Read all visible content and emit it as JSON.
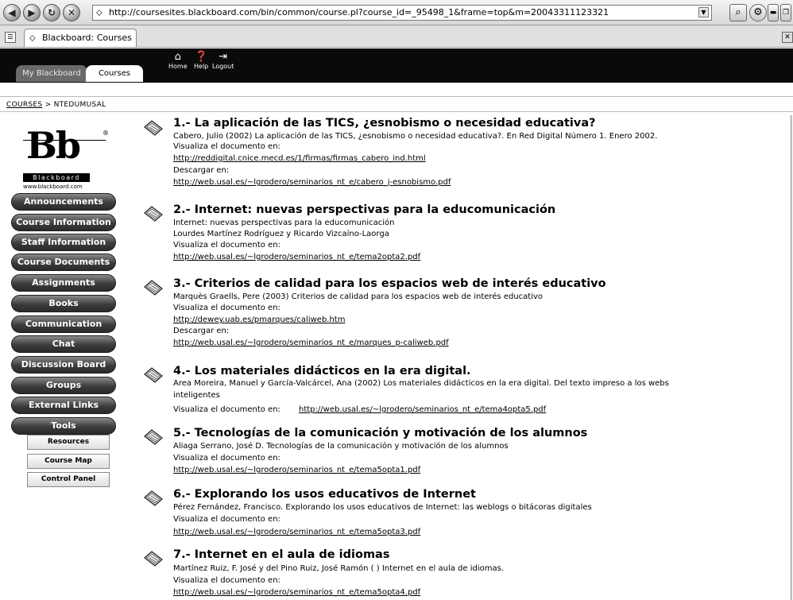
{
  "browser": {
    "url": "http://coursesites.blackboard.com/bin/common/course.pl?course_id=_95498_1&frame=top&m=20043311123321",
    "tab_title": "Blackboard: Courses"
  },
  "bb_header": {
    "tab_myblackboard": "My Blackboard",
    "tab_courses": "Courses",
    "home": "Home",
    "help": "Help",
    "logout": "Logout"
  },
  "breadcrumb": {
    "courses": "COURSES",
    "sep": " > ",
    "current": "NTEDUMUSAL"
  },
  "logo": {
    "mark": "Bb",
    "word": "Blackboard",
    "url": "www.blackboard.com"
  },
  "nav": [
    "Announcements",
    "Course Information",
    "Staff Information",
    "Course Documents",
    "Assignments",
    "Books",
    "Communication",
    "Chat",
    "Discussion Board",
    "Groups",
    "External Links",
    "Tools"
  ],
  "tools_buttons": [
    "Resources",
    "Course Map",
    "Control Panel"
  ],
  "entries": [
    {
      "title": "1.- La aplicación de las TICS, ¿esnobismo o necesidad educativa?",
      "line1": "Cabero, Julio (2002) La aplicación de las TICS, ¿esnobismo o necesidad educativa?. En Red Digital Número 1. Enero 2002.",
      "line2": "Visualiza el documento en:",
      "link1": "http://reddigital.cnice.mecd.es/1/firmas/firmas_cabero_ind.html",
      "line3": "Descargar en:",
      "link2": "http://web.usal.es/~lgrodero/seminarios_nt_e/cabero_j-esnobismo.pdf"
    },
    {
      "title": "2.- Internet: nuevas perspectivas para la educomunicación",
      "line1": "Internet: nuevas perspectivas para la educomunicación",
      "line2": "Lourdes Martínez Rodríguez y Ricardo Vizcaíno-Laorga",
      "line3": "Visualiza el documento en:",
      "link1": "http://web.usal.es/~lgrodero/seminarios_nt_e/tema2opta2.pdf"
    },
    {
      "title": "3.- Criterios de calidad para los espacios web de interés educativo",
      "line1": "Marquès Graells, Pere (2003) Criterios de calidad para los espacios web de interés educativo",
      "line2": "Visualiza el documento en:",
      "link1": "http://dewey.uab.es/pmarques/caliweb.htm",
      "line3": "Descargar en:",
      "link2": "http://web.usal.es/~lgrodero/seminarios_nt_e/marques_p-caliweb.pdf"
    },
    {
      "title": "4.- Los materiales didácticos en la era digital.",
      "line1": "Area Moreira, Manuel y García-Valcárcel, Ana (2002) Los materiales didácticos en la era digital. Del texto impreso a los webs",
      "line2": "inteligentes",
      "line3": "Visualiza el documento en:",
      "link1": "http://web.usal.es/~lgrodero/seminarios_nt_e/tema4opta5.pdf"
    },
    {
      "title": "5.- Tecnologías de la comunicación y motivación de los alumnos",
      "line1": "Aliaga Serrano, José D. Tecnologías de la comunicación y motivación de los alumnos",
      "line2": "Visualiza el documento en:",
      "link1": "http://web.usal.es/~lgrodero/seminarios_nt_e/tema5opta1.pdf"
    },
    {
      "title": "6.- Explorando los usos educativos de Internet",
      "line1": "Pérez Fernández, Francisco. Explorando los usos educativos de Internet: las weblogs o bitácoras digitales",
      "line2": "Visualiza el documento en:",
      "link1": "http://web.usal.es/~lgrodero/seminarios_nt_e/tema5opta3.pdf"
    },
    {
      "title": "7.- Internet en el aula de idiomas",
      "line1": "Martínez Ruiz, F. José y del Pino Ruiz, José Ramón ( ) Internet en el aula de idiomas.",
      "line2": "Visualiza el documento en:",
      "link1": "http://web.usal.es/~lgrodero/seminarios_nt_e/tema5opta4.pdf"
    }
  ]
}
